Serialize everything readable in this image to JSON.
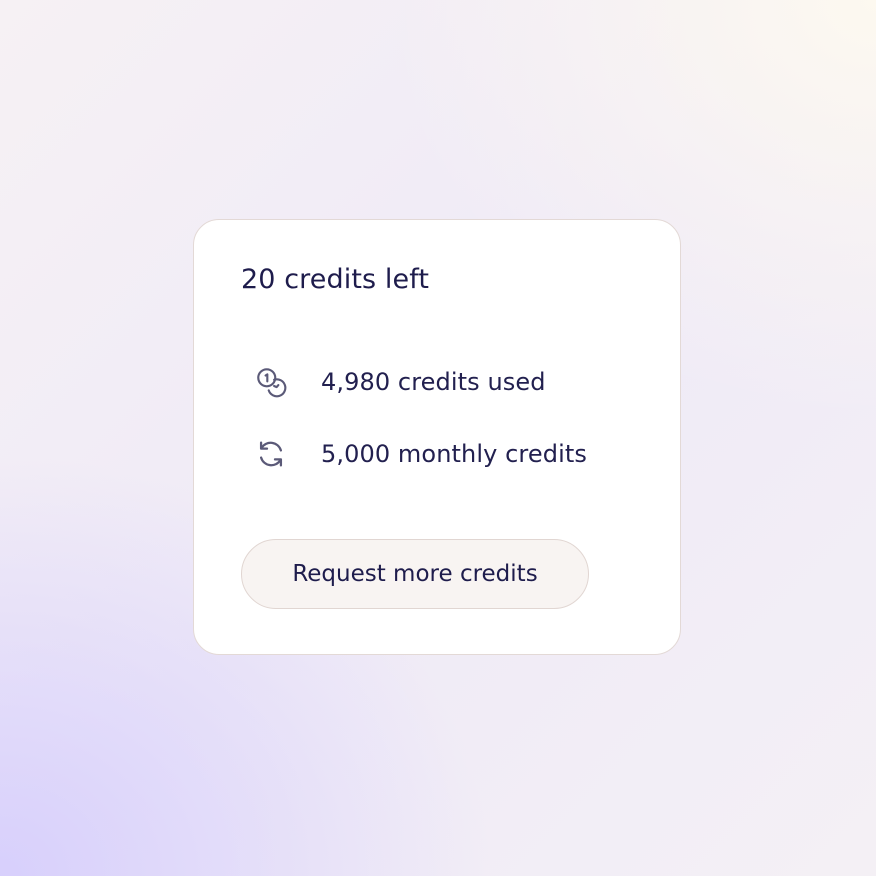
{
  "card": {
    "title": "20 credits left",
    "stats": [
      {
        "icon": "coins-icon",
        "label": "4,980 credits used"
      },
      {
        "icon": "refresh-icon",
        "label": "5,000 monthly credits"
      }
    ],
    "button_label": "Request more credits"
  },
  "colors": {
    "text": "#1e1c4c",
    "icon": "#5b5a78",
    "card_border": "#e3d9d6",
    "button_bg": "#f8f4f2",
    "background_purple": "#d6cefc",
    "background_cream": "#fdf9f0"
  }
}
